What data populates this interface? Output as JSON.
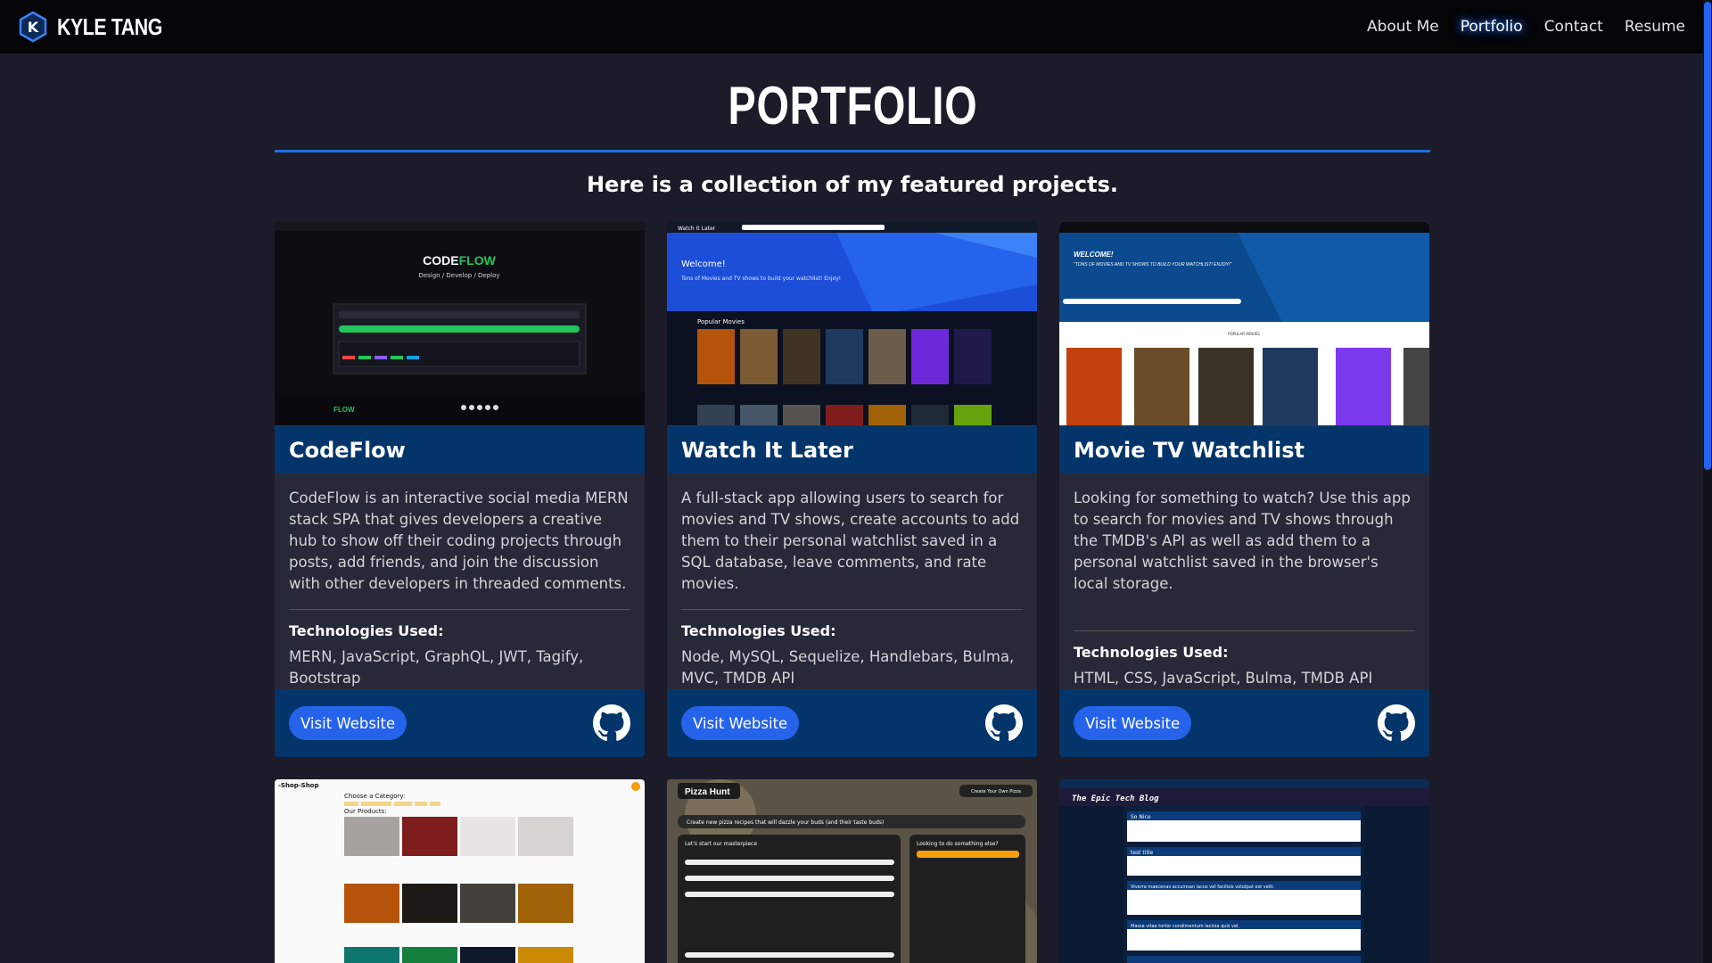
{
  "brand": {
    "initial": "K",
    "name": "KYLE TANG",
    "accent": "#3b82f6"
  },
  "nav": {
    "links": [
      {
        "label": "About Me",
        "active": false
      },
      {
        "label": "Portfolio",
        "active": true
      },
      {
        "label": "Contact",
        "active": false
      },
      {
        "label": "Resume",
        "active": false
      }
    ]
  },
  "page": {
    "title": "PORTFOLIO",
    "subtitle": "Here is a collection of my featured projects."
  },
  "projects": [
    {
      "title": "CodeFlow",
      "description": "CodeFlow is an interactive social media MERN stack SPA that gives developers a creative hub to show off their coding projects through posts, add friends, and join the discussion with other developers in threaded comments.",
      "tech_heading": "Technologies Used:",
      "tech": "MERN, JavaScript, GraphQL, JWT, Tagify, Bootstrap",
      "button": "Visit Website",
      "icon": "github-icon",
      "thumb": {
        "logo_a": "CODE",
        "logo_b": "FLOW",
        "tagline": "Design / Develop / Deploy"
      }
    },
    {
      "title": "Watch It Later",
      "description": "A full-stack app allowing users to search for movies and TV shows, create accounts to add them to their personal watchlist saved in a SQL database, leave comments, and rate movies.",
      "tech_heading": "Technologies Used:",
      "tech": "Node, MySQL, Sequelize, Handlebars, Bulma, MVC, TMDB API",
      "button": "Visit Website",
      "icon": "github-icon",
      "thumb": {
        "nav": "Watch It Later",
        "welcome": "Welcome!",
        "tagline": "Tons of Movies and TV shows to build your watchlist! Enjoy!",
        "section": "Popular Movies"
      }
    },
    {
      "title": "Movie TV Watchlist",
      "description": "Looking for something to watch? Use this app to search for movies and TV shows through the TMDB's API as well as add them to a personal watchlist saved in the browser's local storage.",
      "tech_heading": "Technologies Used:",
      "tech": "HTML, CSS, JavaScript, Bulma, TMDB API",
      "button": "Visit Website",
      "icon": "github-icon",
      "thumb": {
        "welcome": "WELCOME!",
        "tagline": "\"TONS OF MOVIES AND TV SHOWS TO BUILD YOUR WATCHLIST! ENJOY!\"",
        "section": "POPULAR MOVIES"
      }
    }
  ],
  "partial_projects": [
    {
      "thumb": {
        "brand": "-Shop-Shop",
        "heading": "Choose a Category:",
        "products": "Our Products:"
      }
    },
    {
      "thumb": {
        "brand": "Pizza Hunt",
        "banner": "Create new pizza recipes that will dazzle your buds (and their taste buds)",
        "form": "Let's start our masterpiece",
        "side": "Looking to do something else?",
        "btn": "Create Your Own Pizza"
      }
    },
    {
      "thumb": {
        "brand": "The Epic Tech Blog",
        "post1": "So Nice",
        "post2": "test title",
        "post3": "Viverra maecenas accumsan lacus vel facilisis volutpat est velit.",
        "post4": "Massa vitae tortor condimentum lacinia quis vel."
      }
    }
  ]
}
